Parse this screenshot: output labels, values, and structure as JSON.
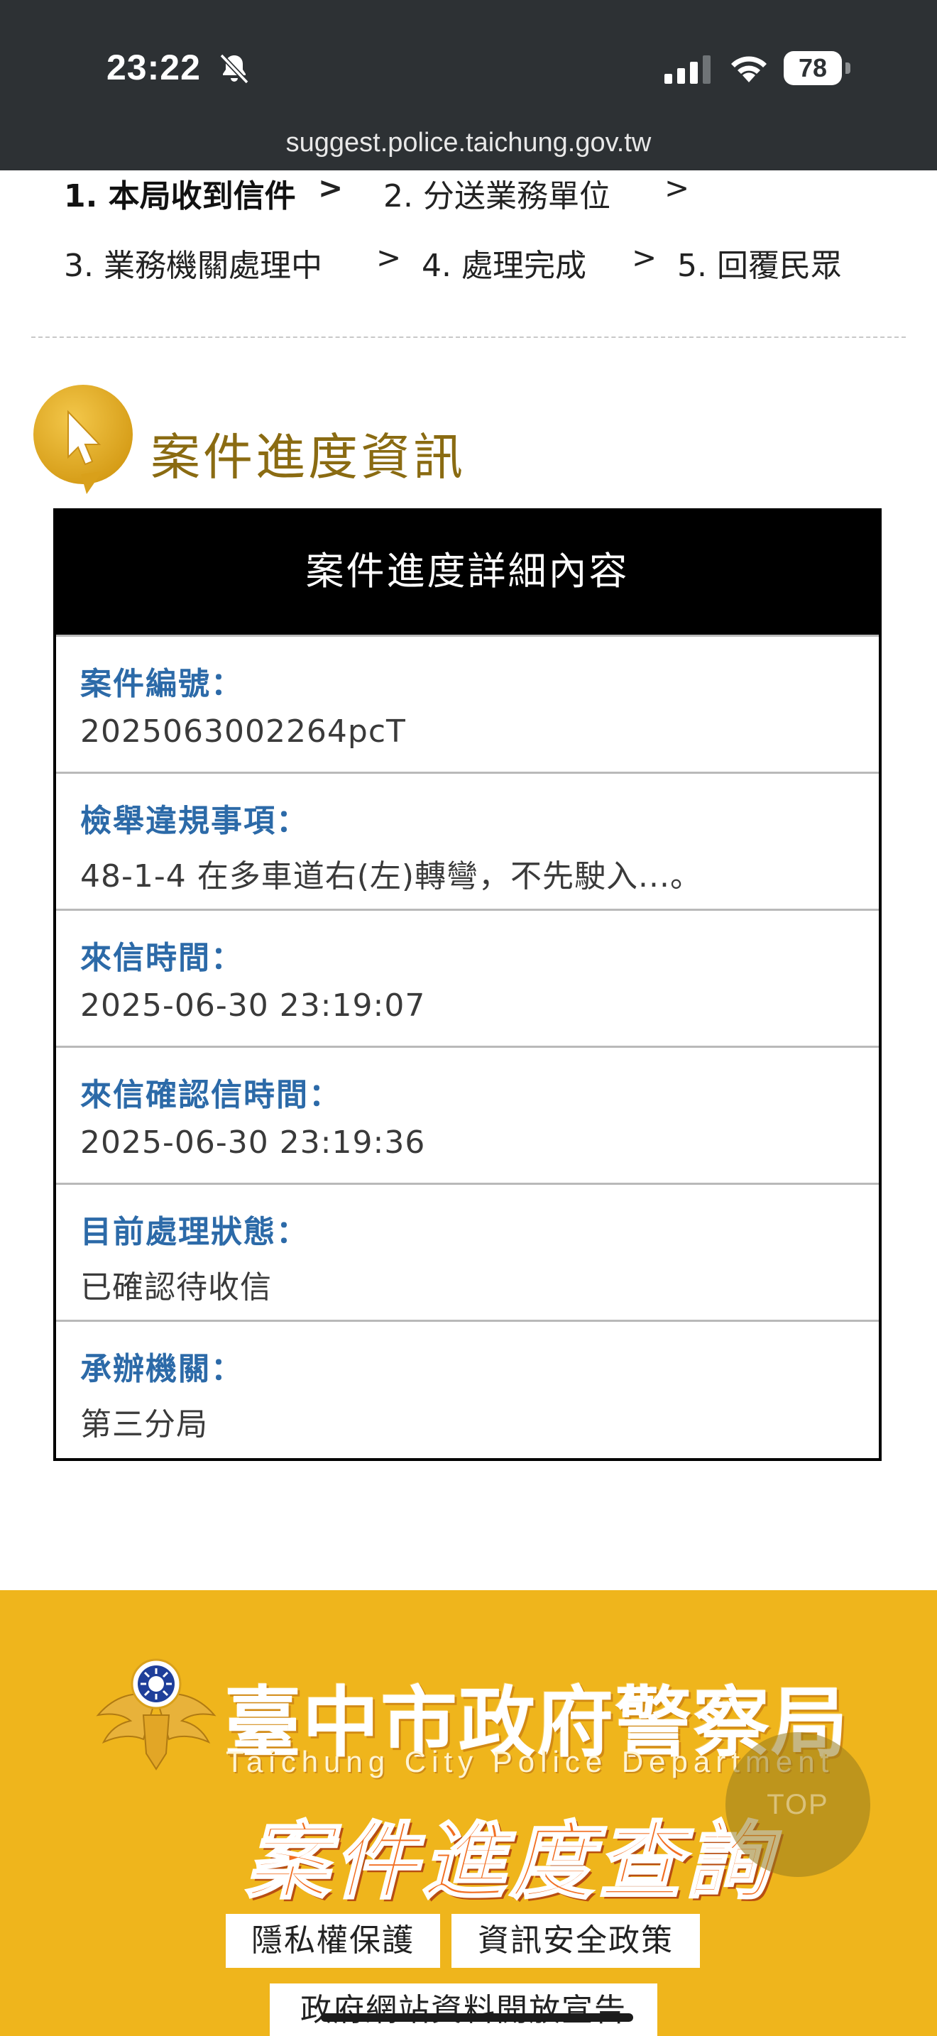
{
  "status_bar": {
    "time": "23:22",
    "battery": "78",
    "icons": [
      "bell-slash-icon",
      "cellular-signal-icon",
      "wifi-icon",
      "battery-icon"
    ]
  },
  "browser": {
    "url": "suggest.police.taichung.gov.tw"
  },
  "steps": [
    {
      "label": "1. 本局收到信件",
      "active": true
    },
    {
      "label": "2. 分送業務單位",
      "active": false
    },
    {
      "label": "3. 業務機關處理中",
      "active": false
    },
    {
      "label": "4. 處理完成",
      "active": false
    },
    {
      "label": "5. 回覆民眾",
      "active": false
    }
  ],
  "step_separator": ">",
  "section": {
    "title": "案件進度資訊",
    "icon": "cursor-pointer-icon",
    "icon_color": "#dba21c"
  },
  "detail": {
    "header": "案件進度詳細內容",
    "rows": [
      {
        "label": "案件編號：",
        "value": "2025063002264pcT"
      },
      {
        "label": "檢舉違規事項：",
        "value": "48-1-4 在多車道右(左)轉彎，不先駛入...。"
      },
      {
        "label": "來信時間：",
        "value": "2025-06-30 23:19:07"
      },
      {
        "label": "來信確認信時間：",
        "value": "2025-06-30 23:19:36"
      },
      {
        "label": "目前處理狀態：",
        "value": "已確認待收信"
      },
      {
        "label": "承辦機關：",
        "value": "第三分局"
      }
    ],
    "label_color": "#2c6aa8"
  },
  "footer": {
    "background": "#efb51c",
    "brand_zh": "臺中市政府警察局",
    "brand_en": "Taichung City Police Department",
    "banner": "案件進度查詢",
    "links": [
      "隱私權保護",
      "資訊安全政策",
      "政府網站資料開放宣告"
    ],
    "top_button": "TOP"
  }
}
